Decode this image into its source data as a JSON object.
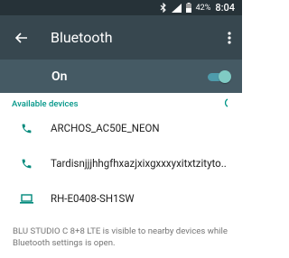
{
  "status_bar": {
    "battery_pct": "42%",
    "time": "8:04"
  },
  "toolbar": {
    "title": "Bluetooth"
  },
  "switch": {
    "label": "On",
    "state": "on"
  },
  "section": {
    "title": "Available devices"
  },
  "devices": [
    {
      "name": "ARCHOS_AC50E_NEON",
      "icon": "phone-icon"
    },
    {
      "name": "Tardisnjjjhhgfhxazjxixgxxxyxitxtzityto..",
      "icon": "phone-icon"
    },
    {
      "name": "RH-E0408-SH1SW",
      "icon": "laptop-icon"
    }
  ],
  "footer": {
    "text": "BLU STUDIO C 8+8 LTE is visible to nearby devices while Bluetooth settings is open."
  },
  "colors": {
    "status_bar": "#263238",
    "toolbar": "#37474f",
    "switch_bar": "#455a64",
    "accent": "#009688"
  }
}
